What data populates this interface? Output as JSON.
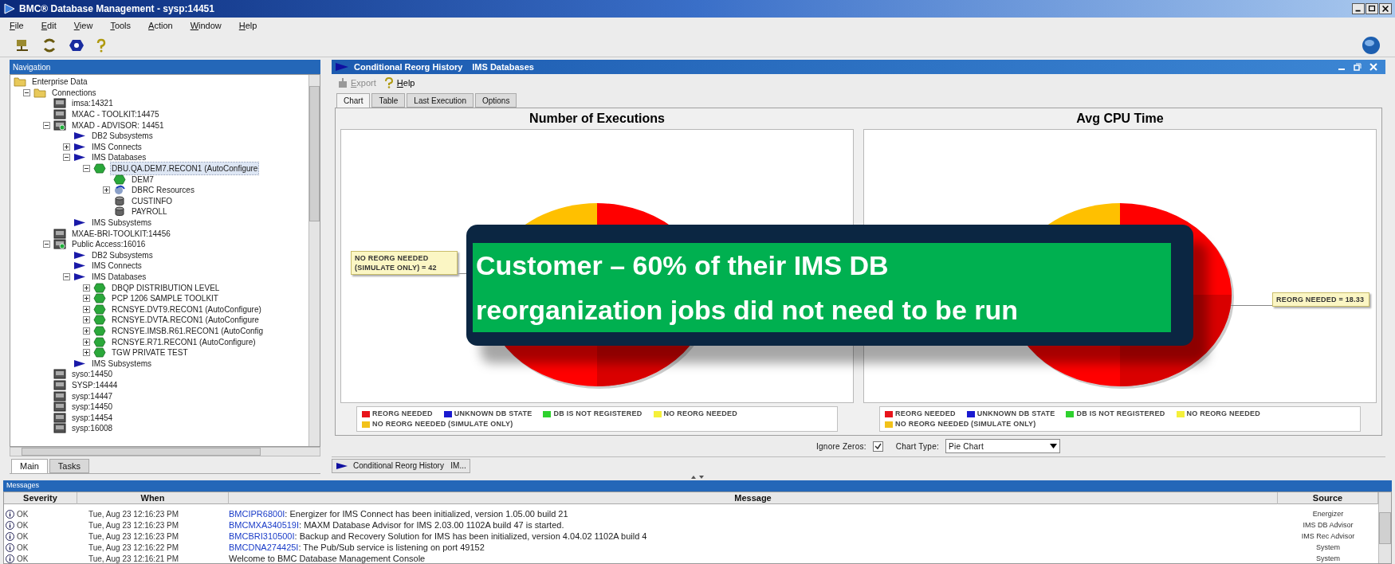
{
  "window": {
    "title": "BMC® Database Management - sysp:14451"
  },
  "menu": [
    "File",
    "Edit",
    "View",
    "Tools",
    "Action",
    "Window",
    "Help"
  ],
  "navigation": {
    "title": "Navigation",
    "tree": [
      {
        "label": "Enterprise Data",
        "kind": "folder",
        "selected": false,
        "children": [
          {
            "label": "Connections",
            "kind": "folder",
            "expanded": true,
            "selected": false,
            "children": [
              {
                "label": "imsa:14321",
                "kind": "server",
                "selected": false
              },
              {
                "label": "MXAC - TOOLKIT:14475",
                "kind": "server",
                "selected": false
              },
              {
                "label": "MXAD - ADVISOR: 14451",
                "kind": "server-on",
                "expanded": true,
                "selected": false,
                "children": [
                  {
                    "label": "DB2 Subsystems",
                    "kind": "subsystem",
                    "selected": false
                  },
                  {
                    "label": "IMS Connects",
                    "kind": "subsystem",
                    "expanded": false,
                    "selected": false
                  },
                  {
                    "label": "IMS Databases",
                    "kind": "subsystem",
                    "expanded": true,
                    "selected": false,
                    "children": [
                      {
                        "label": "DBU.QA.DEM7.RECON1 (AutoConfigure",
                        "kind": "ims",
                        "expanded": true,
                        "selected": true,
                        "children": [
                          {
                            "label": "DEM7",
                            "kind": "ims",
                            "selected": false
                          },
                          {
                            "label": "DBRC Resources",
                            "kind": "dbrc",
                            "expanded": false,
                            "selected": false
                          },
                          {
                            "label": "CUSTINFO",
                            "kind": "database",
                            "selected": false
                          },
                          {
                            "label": "PAYROLL",
                            "kind": "database",
                            "selected": false
                          }
                        ]
                      }
                    ]
                  },
                  {
                    "label": "IMS Subsystems",
                    "kind": "subsystem",
                    "selected": false
                  }
                ]
              },
              {
                "label": "MXAE-BRI-TOOLKIT:14456",
                "kind": "server",
                "selected": false
              },
              {
                "label": "Public Access:16016",
                "kind": "server-on",
                "expanded": true,
                "selected": false,
                "children": [
                  {
                    "label": "DB2 Subsystems",
                    "kind": "subsystem",
                    "selected": false
                  },
                  {
                    "label": "IMS Connects",
                    "kind": "subsystem",
                    "selected": false
                  },
                  {
                    "label": "IMS Databases",
                    "kind": "subsystem",
                    "expanded": true,
                    "selected": false,
                    "children": [
                      {
                        "label": "DBQP DISTRIBUTION LEVEL",
                        "kind": "ims",
                        "expanded": false,
                        "selected": false
                      },
                      {
                        "label": "PCP 1206 SAMPLE TOOLKIT",
                        "kind": "ims",
                        "expanded": false,
                        "selected": false
                      },
                      {
                        "label": "RCNSYE.DVT9.RECON1 (AutoConfigure)",
                        "kind": "ims",
                        "expanded": false,
                        "selected": false
                      },
                      {
                        "label": "RCNSYE.DVTA.RECON1 (AutoConfigure",
                        "kind": "ims",
                        "expanded": false,
                        "selected": false
                      },
                      {
                        "label": "RCNSYE.IMSB.R61.RECON1 (AutoConfig",
                        "kind": "ims",
                        "expanded": false,
                        "selected": false
                      },
                      {
                        "label": "RCNSYE.R71.RECON1 (AutoConfigure)",
                        "kind": "ims",
                        "expanded": false,
                        "selected": false
                      },
                      {
                        "label": "TGW PRIVATE TEST",
                        "kind": "ims",
                        "expanded": false,
                        "selected": false
                      }
                    ]
                  },
                  {
                    "label": "IMS Subsystems",
                    "kind": "subsystem",
                    "selected": false
                  }
                ]
              },
              {
                "label": "syso:14450",
                "kind": "server",
                "selected": false
              },
              {
                "label": "SYSP:14444",
                "kind": "server",
                "selected": false
              },
              {
                "label": "sysp:14447",
                "kind": "server",
                "selected": false
              },
              {
                "label": "sysp:14450",
                "kind": "server",
                "selected": false
              },
              {
                "label": "sysp:14454",
                "kind": "server",
                "selected": false
              },
              {
                "label": "sysp:16008",
                "kind": "server",
                "selected": false
              }
            ]
          }
        ]
      }
    ],
    "tabs": [
      {
        "label": "Main",
        "selected": true
      },
      {
        "label": "Tasks",
        "selected": false
      }
    ]
  },
  "report": {
    "title": "Conditional Reorg History",
    "subtitle": "IMS Databases",
    "actions": [
      {
        "label": "Export",
        "kind": "export",
        "disabled": true
      },
      {
        "label": "Help",
        "kind": "help",
        "disabled": false
      }
    ],
    "tabs": [
      {
        "label": "Chart",
        "selected": true
      },
      {
        "label": "Table",
        "selected": false
      },
      {
        "label": "Last Execution",
        "selected": false
      },
      {
        "label": "Options",
        "selected": false
      }
    ],
    "charts": [
      {
        "title": "Number of Executions",
        "callout": "NO REORG NEEDED (SIMULATE ONLY) = 42",
        "legend": [
          {
            "label": "REORG NEEDED",
            "color": "#e8141b"
          },
          {
            "label": "UNKNOWN DB STATE",
            "color": "#1a1ad0"
          },
          {
            "label": "DB IS NOT REGISTERED",
            "color": "#2ed12e"
          },
          {
            "label": "NO REORG NEEDED",
            "color": "#f5f03a"
          },
          {
            "label": "NO REORG NEEDED (SIMULATE ONLY)",
            "color": "#f2c21a"
          }
        ]
      },
      {
        "title": "Avg CPU Time",
        "callout": "REORG NEEDED = 18.33",
        "legend": [
          {
            "label": "REORG NEEDED",
            "color": "#e8141b"
          },
          {
            "label": "UNKNOWN DB STATE",
            "color": "#1a1ad0"
          },
          {
            "label": "DB IS NOT REGISTERED",
            "color": "#2ed12e"
          },
          {
            "label": "NO REORG NEEDED",
            "color": "#f5f03a"
          },
          {
            "label": "NO REORG NEEDED (SIMULATE ONLY)",
            "color": "#f2c21a"
          }
        ]
      }
    ],
    "ignore_zeros": {
      "label": "Ignore Zeros:",
      "checked": true
    },
    "chart_type": {
      "label": "Chart Type:",
      "value": "Pie Chart"
    },
    "document_tab": "Conditional Reorg History   IM..."
  },
  "messages": {
    "title": "Messages",
    "columns": [
      "Severity",
      "When",
      "Message",
      "Source"
    ],
    "rows": [
      {
        "severity": "OK",
        "when": "Tue, Aug 23 12:16:23 PM",
        "code": "BMCIPR6800I",
        "text": ": Energizer for IMS Connect has been initialized, version 1.05.00 build 21",
        "source": "Energizer"
      },
      {
        "severity": "OK",
        "when": "Tue, Aug 23 12:16:23 PM",
        "code": "BMCMXA340519I",
        "text": ": MAXM Database Advisor for IMS 2.03.00 1102A build 47 is started.",
        "source": "IMS DB Advisor"
      },
      {
        "severity": "OK",
        "when": "Tue, Aug 23 12:16:23 PM",
        "code": "BMCBRI310500I",
        "text": ": Backup and Recovery Solution for IMS has been initialized,  version 4.04.02 1102A build 4",
        "source": "IMS Rec Advisor"
      },
      {
        "severity": "OK",
        "when": "Tue, Aug 23 12:16:22 PM",
        "code": "BMCDNA274425I",
        "text": ": The Pub/Sub service is listening on port 49152",
        "source": "System"
      },
      {
        "severity": "OK",
        "when": "Tue, Aug 23 12:16:21 PM",
        "text": "Welcome to BMC Database Management Console",
        "source": "System"
      }
    ]
  },
  "caption": {
    "lines": [
      "Customer – 60% of their IMS DB",
      "reorganization jobs did not need to be run"
    ]
  }
}
